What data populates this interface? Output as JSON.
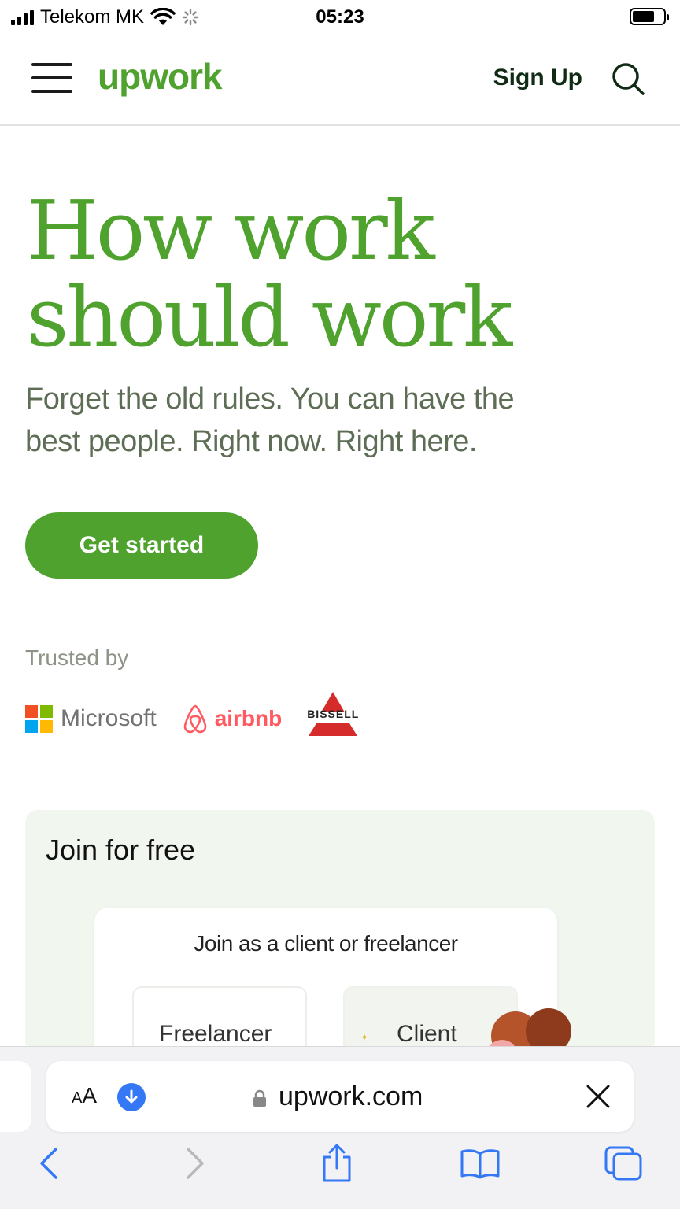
{
  "status_bar": {
    "carrier": "Telekom MK",
    "time": "05:23",
    "battery_level": 0.7,
    "icons": [
      "signal-icon",
      "wifi-icon",
      "loading-icon",
      "battery-icon"
    ]
  },
  "header": {
    "logo": "upwork",
    "signup_label": "Sign Up",
    "icons": [
      "hamburger-menu-icon",
      "search-icon"
    ]
  },
  "hero": {
    "title_line1": "How work",
    "title_line2": "should work",
    "subtitle_line1": "Forget the old rules. You can have the",
    "subtitle_line2": "best people. Right now. Right here.",
    "cta_label": "Get started"
  },
  "trusted": {
    "label": "Trusted by",
    "logos": [
      {
        "name": "Microsoft",
        "text": "Microsoft"
      },
      {
        "name": "airbnb",
        "text": "airbnb"
      },
      {
        "name": "Bissell",
        "text": "BISSELL"
      }
    ]
  },
  "join": {
    "title": "Join for free",
    "inner_title": "Join as a client or freelancer",
    "options": [
      "Freelancer",
      "Client"
    ]
  },
  "browser": {
    "aa_label_small": "A",
    "aa_label_large": "A",
    "url": "upwork.com",
    "icons": [
      "download-icon",
      "lock-icon",
      "close-icon",
      "back-icon",
      "forward-icon",
      "share-icon",
      "bookmarks-icon",
      "tabs-icon"
    ]
  },
  "colors": {
    "brand_green": "#4fa22e",
    "subtitle_gray": "#5e6d55",
    "safari_blue": "#3478f6"
  }
}
